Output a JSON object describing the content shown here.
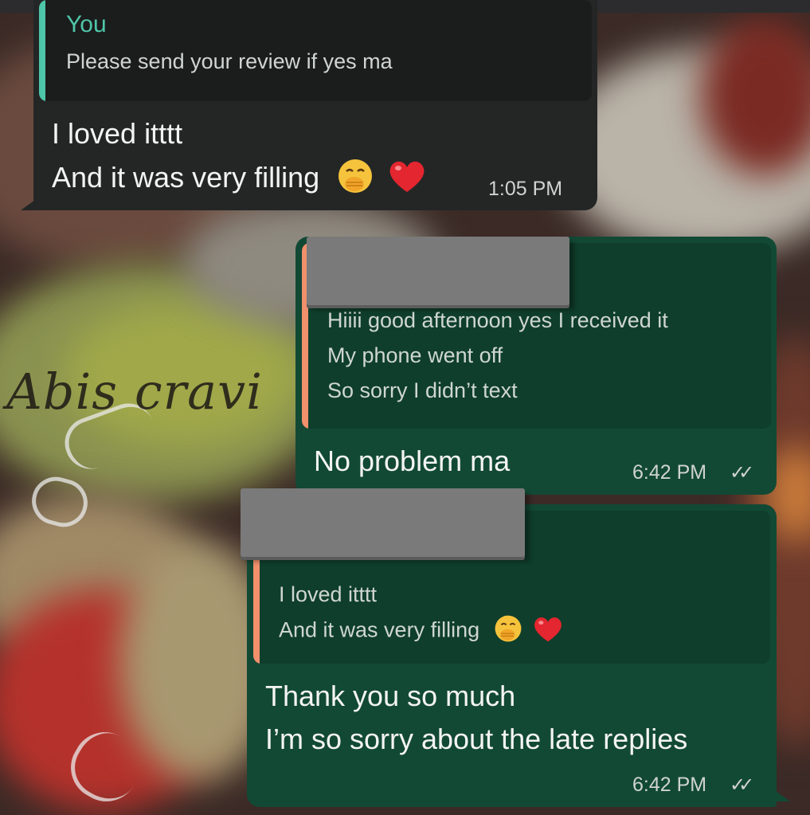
{
  "colors": {
    "incoming_bubble": "#242626",
    "outgoing_bubble": "#124935",
    "quote_bar_you": "#4ec6a8",
    "quote_bar_other": "#f0906c",
    "you_label": "#4ec6a8"
  },
  "wallpaper": {
    "watermark": "Abis cravi"
  },
  "messages": [
    {
      "quote": {
        "author": "You",
        "text": "Please send your review if yes ma"
      },
      "lines": [
        "I loved itttt",
        "And it was very filling"
      ],
      "emojis": [
        "face-with-hand-over-mouth-icon",
        "red-heart-icon"
      ],
      "time": "1:05 PM"
    },
    {
      "quote": {
        "lines": [
          "Hiiii good afternoon yes I received it",
          "My phone went off",
          "So sorry I didn’t text"
        ]
      },
      "text": "No problem ma",
      "time": "6:42 PM",
      "status": "read"
    },
    {
      "quote": {
        "lines": [
          "I loved itttt",
          "And it was very filling"
        ]
      },
      "lines": [
        "Thank you so much",
        "I’m so sorry about the late replies"
      ],
      "time": "6:42 PM",
      "status": "read"
    }
  ]
}
